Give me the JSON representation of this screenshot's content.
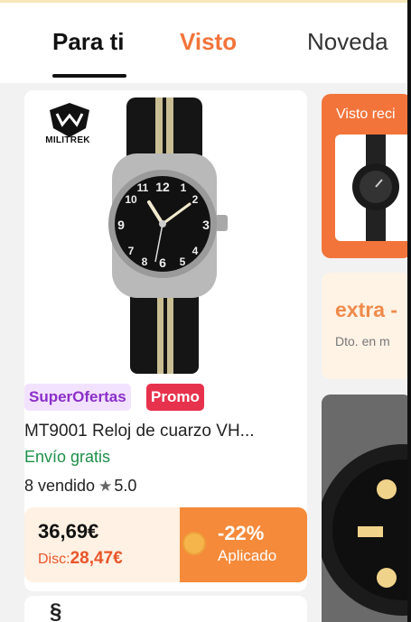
{
  "tabs": [
    {
      "label": "Para ti"
    },
    {
      "label": "Visto"
    },
    {
      "label": "Noveda"
    }
  ],
  "product": {
    "brand": "MILITREK",
    "badge_super": "SuperOfertas",
    "badge_promo": "Promo",
    "title": "MT9001 Reloj de cuarzo VH...",
    "shipping": "Envío gratis",
    "sold": "8 vendido",
    "rating": "5.0",
    "price": "36,69€",
    "disc_label": "Disc:",
    "disc_price": "28,47€",
    "discount": "-22%",
    "applied": "Aplicado"
  },
  "side": {
    "recent_label": "Visto reci",
    "extra_title": "extra -",
    "extra_sub": "Dto. en m"
  },
  "colors": {
    "accent": "#f2743b",
    "promo": "#e7324d",
    "super": "#8b2fc9",
    "shipping": "#1f8f4a"
  }
}
